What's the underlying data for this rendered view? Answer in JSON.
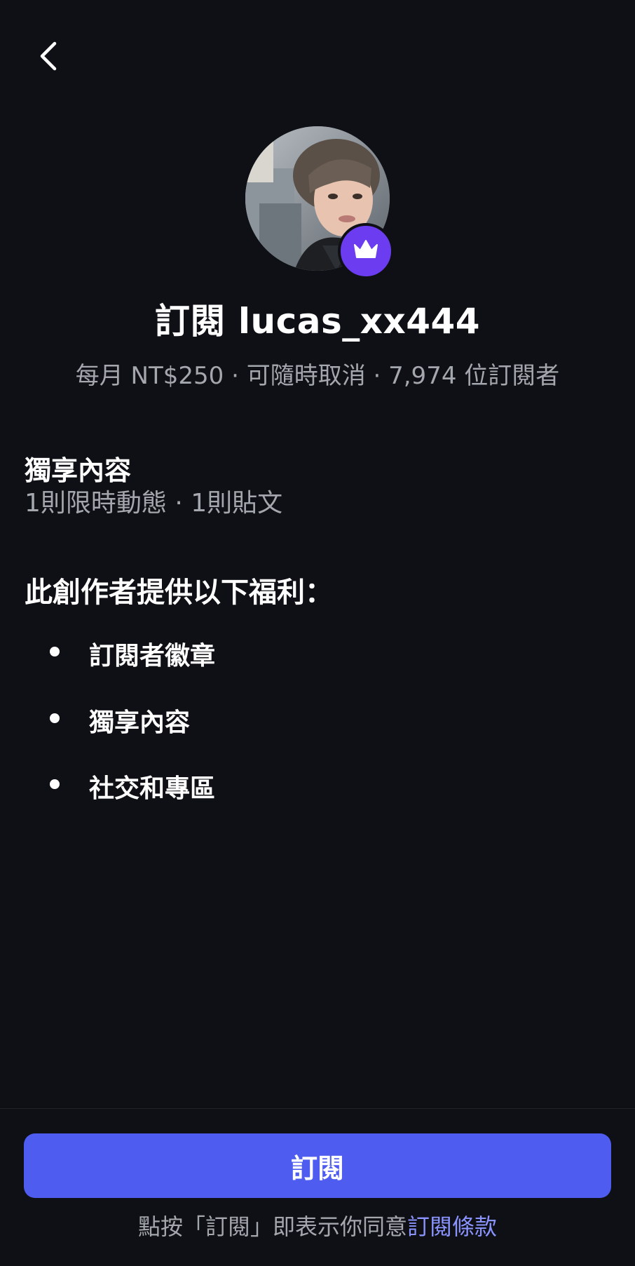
{
  "header": {
    "back_icon": "chevron-left-icon"
  },
  "profile": {
    "username": "lucas_xx444",
    "title": "訂閱 lucas_xx444",
    "badge_icon": "crown-icon",
    "badge_color": "#6c3cf0",
    "subtitle": "每月 NT$250 · 可隨時取消 · 7,974 位訂閱者"
  },
  "exclusive": {
    "heading": "獨享內容",
    "detail": "1則限時動態 · 1則貼文"
  },
  "benefits": {
    "heading": "此創作者提供以下福利：",
    "items": [
      {
        "label": "訂閱者徽章"
      },
      {
        "label": "獨享內容"
      },
      {
        "label": "社交和專區"
      }
    ]
  },
  "footer": {
    "subscribe_label": "訂閱",
    "subscribe_color": "#4e5df0",
    "terms_prefix": "點按「訂閱」即表示你同意",
    "terms_link": "訂閱條款"
  }
}
